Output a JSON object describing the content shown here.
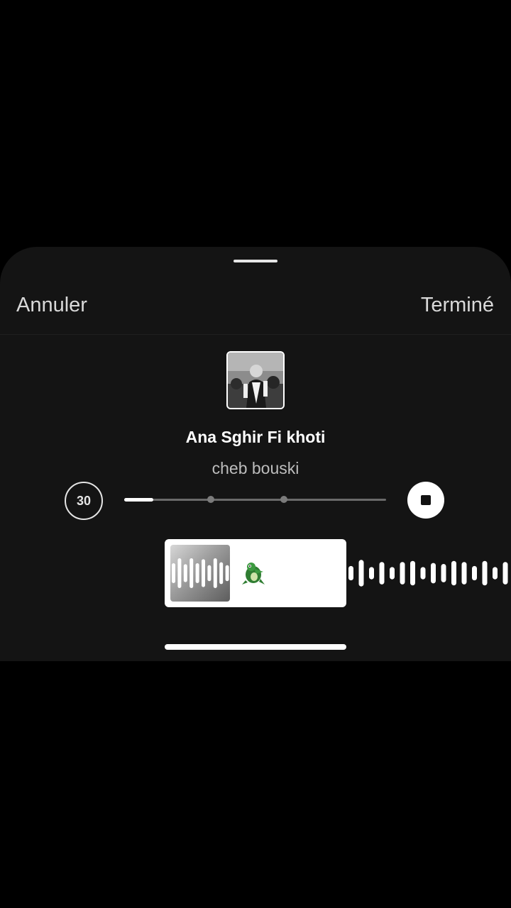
{
  "header": {
    "cancel_label": "Annuler",
    "done_label": "Terminé"
  },
  "track": {
    "title": "Ana Sghir Fi khoti",
    "artist": "cheb bouski",
    "cover_icon": "album-cover-photo"
  },
  "player": {
    "duration_label": "30",
    "progress_fraction": 0.11,
    "progress_markers": [
      0.33,
      0.61
    ],
    "stop_icon": "stop-icon"
  },
  "waveform": {
    "bar_heights": [
      0.35,
      0.65,
      0.3,
      0.55,
      0.3,
      0.55,
      0.6,
      0.3,
      0.5,
      0.45,
      0.6,
      0.55,
      0.35,
      0.6,
      0.3,
      0.55
    ],
    "clip_bar_heights": [
      0.5,
      0.75,
      0.45,
      0.75,
      0.5,
      0.7,
      0.4,
      0.75,
      0.55,
      0.4
    ],
    "sticker_icon": "green-crocodile-sticker"
  },
  "colors": {
    "sheet_background": "#141414",
    "accent": "#ffffff"
  }
}
